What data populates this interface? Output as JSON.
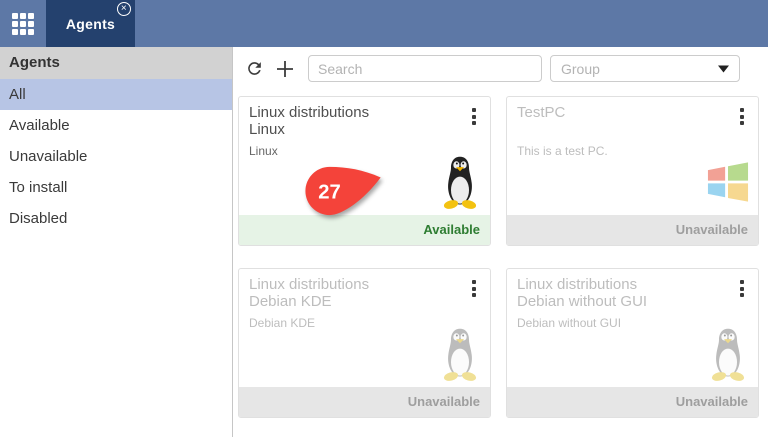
{
  "topbar": {
    "tab": {
      "label": "Agents"
    }
  },
  "icons": {
    "app_grid": "app-grid-icon",
    "tab_close_glyph": "×",
    "refresh": "refresh-icon",
    "add": "plus-icon",
    "caret_down": "caret-down-icon",
    "kebab": "kebab-menu-icon",
    "tux": "tux-penguin-icon",
    "windows": "windows-logo-icon"
  },
  "sidebar": {
    "header": "Agents",
    "items": [
      {
        "label": "All",
        "selected": true
      },
      {
        "label": "Available",
        "selected": false
      },
      {
        "label": "Unavailable",
        "selected": false
      },
      {
        "label": "To install",
        "selected": false
      },
      {
        "label": "Disabled",
        "selected": false
      }
    ]
  },
  "toolbar": {
    "search_placeholder": "Search",
    "group_placeholder": "Group"
  },
  "cards": [
    {
      "title": "Linux distributions",
      "subtitle": "Linux",
      "description": "Linux",
      "icon": "tux-penguin",
      "badge_count": "27",
      "status": "Available",
      "status_type": "available"
    },
    {
      "title": "TestPC",
      "subtitle": "",
      "description": "This is a test PC.",
      "icon": "windows-logo",
      "status": "Unavailable",
      "status_type": "unavailable"
    },
    {
      "title": "Linux distributions",
      "subtitle": "Debian KDE",
      "description": "Debian KDE",
      "icon": "tux-penguin",
      "status": "Unavailable",
      "status_type": "unavailable"
    },
    {
      "title": "Linux distributions",
      "subtitle": "Debian without GUI",
      "description": "Debian without GUI",
      "icon": "tux-penguin",
      "status": "Unavailable",
      "status_type": "unavailable"
    }
  ],
  "colors": {
    "topbar_blue": "#5d78a6",
    "tab_navy": "#24416e",
    "selected_item_blue": "#b7c5e5",
    "sidebar_header_gray": "#d2d2d2",
    "available_text": "#2e7d32",
    "available_bg": "#e6f3e6",
    "unavailable_text": "#9e9e9e",
    "unavailable_bg": "#e6e6e6",
    "badge_red": "#f4433a"
  }
}
